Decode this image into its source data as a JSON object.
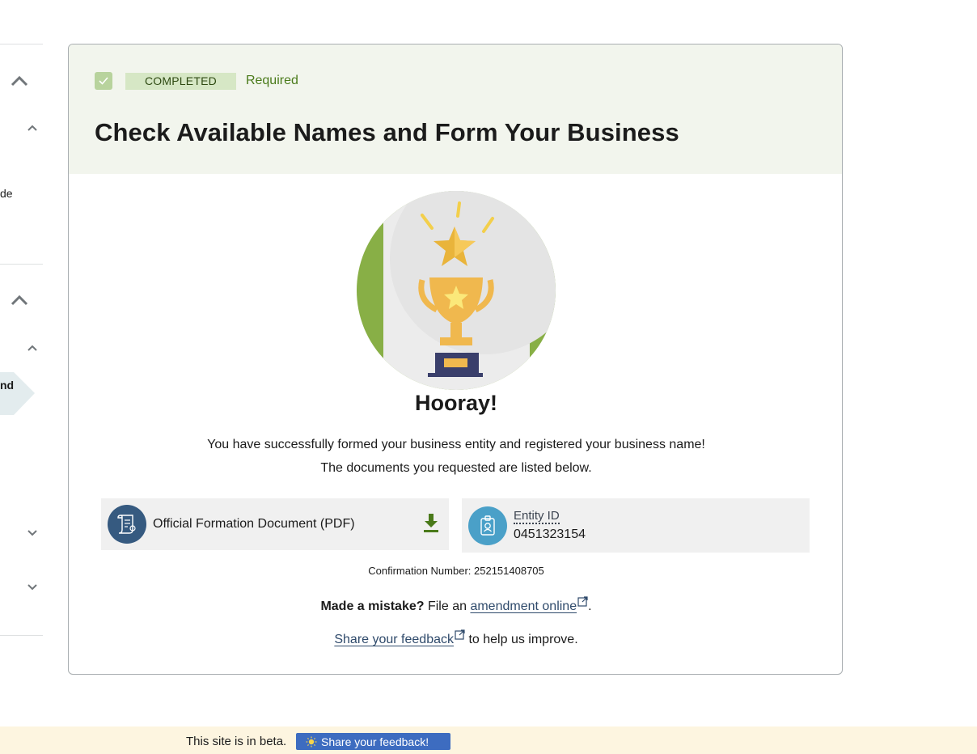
{
  "sidebar": {
    "partial_item_1": "de",
    "active_item_partial": "nd"
  },
  "task": {
    "status_tag": "COMPLETED",
    "required_label": "Required",
    "title": "Check Available Names and Form Your Business"
  },
  "success": {
    "heading": "Hooray!",
    "message_line1": "You have successfully formed your business entity and registered your business name!",
    "message_line2": "The documents you requested are listed below."
  },
  "documents": {
    "formation_doc_label": "Official Formation Document (PDF)",
    "entity_id_label": "Entity ID",
    "entity_id_value": "0451323154"
  },
  "confirmation": {
    "text": "Confirmation Number: 252151408705"
  },
  "mistake": {
    "bold": "Made a mistake?",
    "prefix": "File an",
    "link_text": "amendment online",
    "suffix": "."
  },
  "feedback": {
    "link_text": "Share your feedback",
    "suffix": "to help us improve."
  },
  "beta_banner": {
    "text": "This site is in beta.",
    "button_label": "Share your feedback!"
  },
  "colors": {
    "header_bg": "#f2f5ed",
    "tag_bg": "#d6e7c5",
    "accent_green": "#4a7a1a",
    "link": "#2f4a6b",
    "beta_button": "#3d6cc0",
    "banner_bg": "#fdf5e0"
  }
}
